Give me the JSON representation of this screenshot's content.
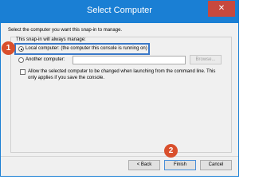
{
  "window": {
    "title": "Select Computer",
    "close_symbol": "✕"
  },
  "content": {
    "instruction": "Select the computer you want this snap-in to manage.",
    "group_label": "This snap-in will always manage:",
    "local_option": "Local computer:  (the computer this console is running on)",
    "another_option": "Another computer:",
    "another_value": "",
    "browse_label": "Browse...",
    "allow_label_line1": "Allow the selected computer to be changed when launching from the command line.  This",
    "allow_label_line2": "only applies if you save the console."
  },
  "buttons": {
    "back": "< Back",
    "finish": "Finish",
    "cancel": "Cancel"
  },
  "callouts": {
    "one": "1",
    "two": "2"
  },
  "colors": {
    "title_bar": "#1a7fd4",
    "callout": "#d94f2c",
    "highlight": "#3a78c8"
  }
}
